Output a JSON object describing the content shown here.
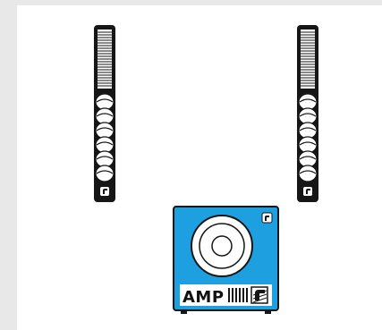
{
  "colors": {
    "page_bg": "#e8e8e8",
    "panel_bg": "#ffffff",
    "device_black": "#161616",
    "amp_blue": "#1ea0e0",
    "white": "#ffffff"
  },
  "devices": {
    "left_column_speaker": {
      "icon": "column-speaker-icon",
      "badge_icon": "logo-badge-icon"
    },
    "right_column_speaker": {
      "icon": "column-speaker-icon",
      "badge_icon": "logo-badge-icon"
    },
    "amplifier": {
      "label": "AMP",
      "icon": "amplifier-speaker-icon",
      "badge_icon": "logo-badge-icon"
    }
  }
}
